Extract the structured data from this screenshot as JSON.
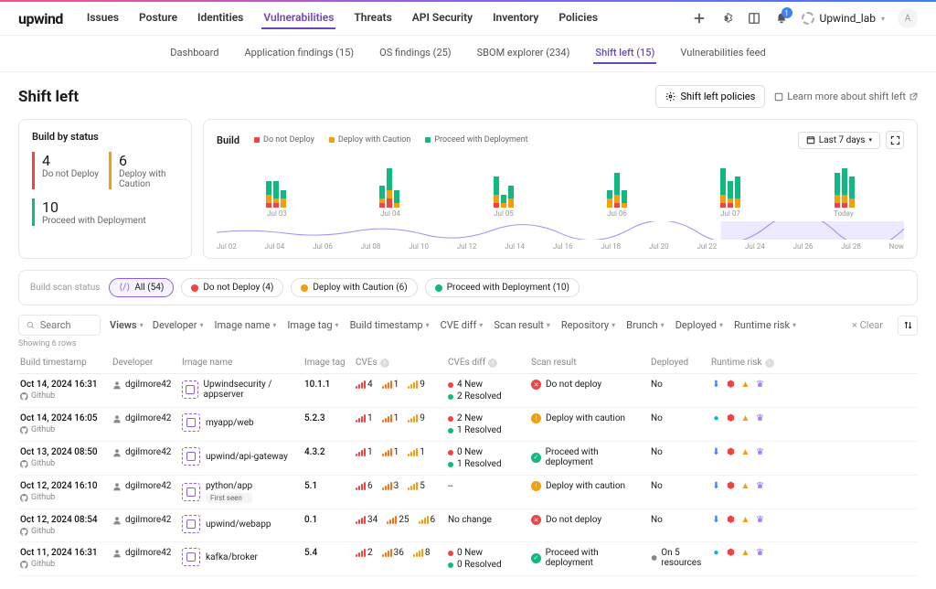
{
  "header": {
    "logo": "upwind",
    "nav": [
      "Issues",
      "Posture",
      "Identities",
      "Vulnerabilities",
      "Threats",
      "API Security",
      "Inventory",
      "Policies"
    ],
    "nav_active_index": 3,
    "notif_count": "1",
    "org_name": "Upwind_lab",
    "avatar_letter": "A"
  },
  "subnav": {
    "items": [
      "Dashboard",
      "Application findings (15)",
      "OS findings (25)",
      "SBOM explorer (234)",
      "Shift left (15)",
      "Vulnerabilities feed"
    ],
    "active_index": 4
  },
  "page": {
    "title": "Shift left",
    "policies_btn": "Shift left policies",
    "learn_more": "Learn more about shift left"
  },
  "build_status": {
    "title": "Build by status",
    "items": [
      {
        "count": "4",
        "label": "Do not Deploy",
        "color": "red"
      },
      {
        "count": "6",
        "label": "Deploy with Caution",
        "color": "yellow"
      },
      {
        "count": "10",
        "label": "Proceed with Deployment",
        "color": "green"
      }
    ]
  },
  "chart": {
    "title": "Build",
    "legend": [
      "Do not Deploy",
      "Deploy with Caution",
      "Proceed with Deployment"
    ],
    "range_label": "Last 7 days",
    "top_axis": [
      "Jul 03",
      "Jul 04",
      "Jul 05",
      "Jul 06",
      "Jul 07",
      "Today"
    ],
    "bottom_axis": [
      "Jul 02",
      "Jul 04",
      "Jul 06",
      "Jul 08",
      "Jul 10",
      "Jul 12",
      "Jul 14",
      "Jul 16",
      "Jul 18",
      "Jul 20",
      "Jul 22",
      "Jul 24",
      "Jul 26",
      "Jul 28",
      "Now"
    ]
  },
  "chart_data": {
    "type": "bar",
    "stacked": true,
    "series_names": [
      "Do not Deploy",
      "Deploy with Caution",
      "Proceed with Deployment"
    ],
    "groups": [
      "Jul 03",
      "Jul 04",
      "Jul 05",
      "Jul 06",
      "Jul 07",
      "Today"
    ],
    "bars_per_group": 3,
    "data": [
      [
        [
          1,
          2,
          3
        ],
        [
          1,
          1,
          4
        ],
        [
          0,
          2,
          2
        ]
      ],
      [
        [
          1,
          1,
          3
        ],
        [
          2,
          2,
          5
        ],
        [
          0,
          1,
          3
        ]
      ],
      [
        [
          1,
          2,
          4
        ],
        [
          0,
          1,
          2
        ],
        [
          0,
          2,
          3
        ]
      ],
      [
        [
          0,
          2,
          2
        ],
        [
          1,
          2,
          5
        ],
        [
          0,
          1,
          3
        ]
      ],
      [
        [
          1,
          2,
          6
        ],
        [
          1,
          1,
          4
        ],
        [
          0,
          2,
          5
        ]
      ],
      [
        [
          1,
          2,
          5
        ],
        [
          1,
          2,
          6
        ],
        [
          0,
          2,
          5
        ]
      ]
    ],
    "y_unit": "builds",
    "ylim": [
      0,
      10
    ]
  },
  "filter_chips": {
    "label": "Build scan status",
    "chips": [
      {
        "label": "All (54)",
        "type": "all",
        "active": true
      },
      {
        "label": "Do not Deploy (4)",
        "type": "red"
      },
      {
        "label": "Deploy with Caution (6)",
        "type": "yellow"
      },
      {
        "label": "Proceed with Deployment (10)",
        "type": "green"
      }
    ]
  },
  "table_controls": {
    "search_placeholder": "Search",
    "views": "Views",
    "filters": [
      "Developer",
      "Image name",
      "Image tag",
      "Build timestamp",
      "CVE diff",
      "Scan result",
      "Repository",
      "Brunch",
      "Deployed",
      "Runtime risk"
    ],
    "clear": "Clear"
  },
  "showing": "Showing 6 rows",
  "columns": [
    "Build timestamp",
    "Developer",
    "Image name",
    "Image tag",
    "CVEs",
    "CVEs diff",
    "Scan result",
    "Deployed",
    "Runtime risk"
  ],
  "rows": [
    {
      "timestamp": "Oct 14, 2024 16:31",
      "repo": "Github",
      "developer": "dgilmore42",
      "image": "Upwindsecurity / appserver",
      "first_seen": false,
      "tag": "10.1.1",
      "cves": [
        {
          "sev": "red",
          "n": "4"
        },
        {
          "sev": "orange",
          "n": "1"
        },
        {
          "sev": "yellow",
          "n": "9"
        }
      ],
      "diff": [
        {
          "dot": "red",
          "text": "4 New"
        },
        {
          "dot": "green",
          "text": "2 Resolved"
        }
      ],
      "scan": {
        "icon": "red",
        "text": "Do not deploy"
      },
      "deployed": "No",
      "risk": [
        "blue-down",
        "red-shield",
        "orange-flame",
        "purple-crown"
      ]
    },
    {
      "timestamp": "Oct 14, 2024 16:05",
      "repo": "Github",
      "developer": "dgilmore42",
      "image": "myapp/web",
      "first_seen": false,
      "tag": "5.2.3",
      "cves": [
        {
          "sev": "red",
          "n": "1"
        },
        {
          "sev": "orange",
          "n": "1"
        },
        {
          "sev": "yellow",
          "n": "9"
        }
      ],
      "diff": [
        {
          "dot": "red",
          "text": "2 New"
        },
        {
          "dot": "green",
          "text": "1 Resolved"
        }
      ],
      "scan": {
        "icon": "yellow",
        "text": "Deploy with caution"
      },
      "deployed": "No",
      "risk": [
        "cyan-dot",
        "red-shield",
        "orange-flame",
        "purple-crown"
      ]
    },
    {
      "timestamp": "Oct 13, 2024 08:50",
      "repo": "Github",
      "developer": "dgilmore42",
      "image": "upwind/api-gateway",
      "first_seen": false,
      "tag": "4.3.2",
      "cves": [
        {
          "sev": "red",
          "n": "1"
        },
        {
          "sev": "orange",
          "n": "1"
        },
        {
          "sev": "yellow",
          "n": "1"
        }
      ],
      "diff": [
        {
          "dot": "red",
          "text": "0 New"
        },
        {
          "dot": "green",
          "text": "1 Resolved"
        }
      ],
      "scan": {
        "icon": "green",
        "text": "Proceed with deployment"
      },
      "deployed": "No",
      "risk": [
        "blue-down",
        "red-shield",
        "orange-flame",
        "purple-crown"
      ]
    },
    {
      "timestamp": "Oct 12, 2024 16:10",
      "repo": "Github",
      "developer": "dgilmore42",
      "image": "python/app",
      "first_seen": true,
      "tag": "5.1",
      "cves": [
        {
          "sev": "red",
          "n": "6"
        },
        {
          "sev": "orange",
          "n": "3"
        },
        {
          "sev": "yellow",
          "n": "5"
        }
      ],
      "diff": [
        {
          "text": "--"
        }
      ],
      "scan": {
        "icon": "yellow",
        "text": "Deploy with caution"
      },
      "deployed": "No",
      "risk": [
        "blue-down",
        "red-shield",
        "orange-flame",
        "purple-crown"
      ]
    },
    {
      "timestamp": "Oct 12, 2024 08:54",
      "repo": "Github",
      "developer": "dgilmore42",
      "image": "upwind/webapp",
      "first_seen": false,
      "tag": "0.1",
      "cves": [
        {
          "sev": "red",
          "n": "34"
        },
        {
          "sev": "orange",
          "n": "25"
        },
        {
          "sev": "yellow",
          "n": "6"
        }
      ],
      "diff": [
        {
          "text": "No change"
        }
      ],
      "scan": {
        "icon": "red",
        "text": "Do not deploy"
      },
      "deployed": "No",
      "risk": [
        "blue-down",
        "red-shield",
        "orange-flame",
        "purple-crown"
      ]
    },
    {
      "timestamp": "Oct 11, 2024 16:31",
      "repo": "Github",
      "developer": "dgilmore42",
      "image": "kafka/broker",
      "first_seen": false,
      "tag": "5.4",
      "cves": [
        {
          "sev": "red",
          "n": "2"
        },
        {
          "sev": "orange",
          "n": "36"
        },
        {
          "sev": "yellow",
          "n": "8"
        }
      ],
      "diff": [
        {
          "dot": "red",
          "text": "0 New"
        },
        {
          "dot": "green",
          "text": "0 Resolved"
        }
      ],
      "scan": {
        "icon": "green",
        "text": "Proceed with deployment"
      },
      "deployed": "On 5 resources",
      "deployed_icon": true,
      "risk": [
        "cyan-dot",
        "red-shield",
        "orange-flame",
        "purple-crown"
      ]
    }
  ],
  "first_seen_label": "First seen"
}
